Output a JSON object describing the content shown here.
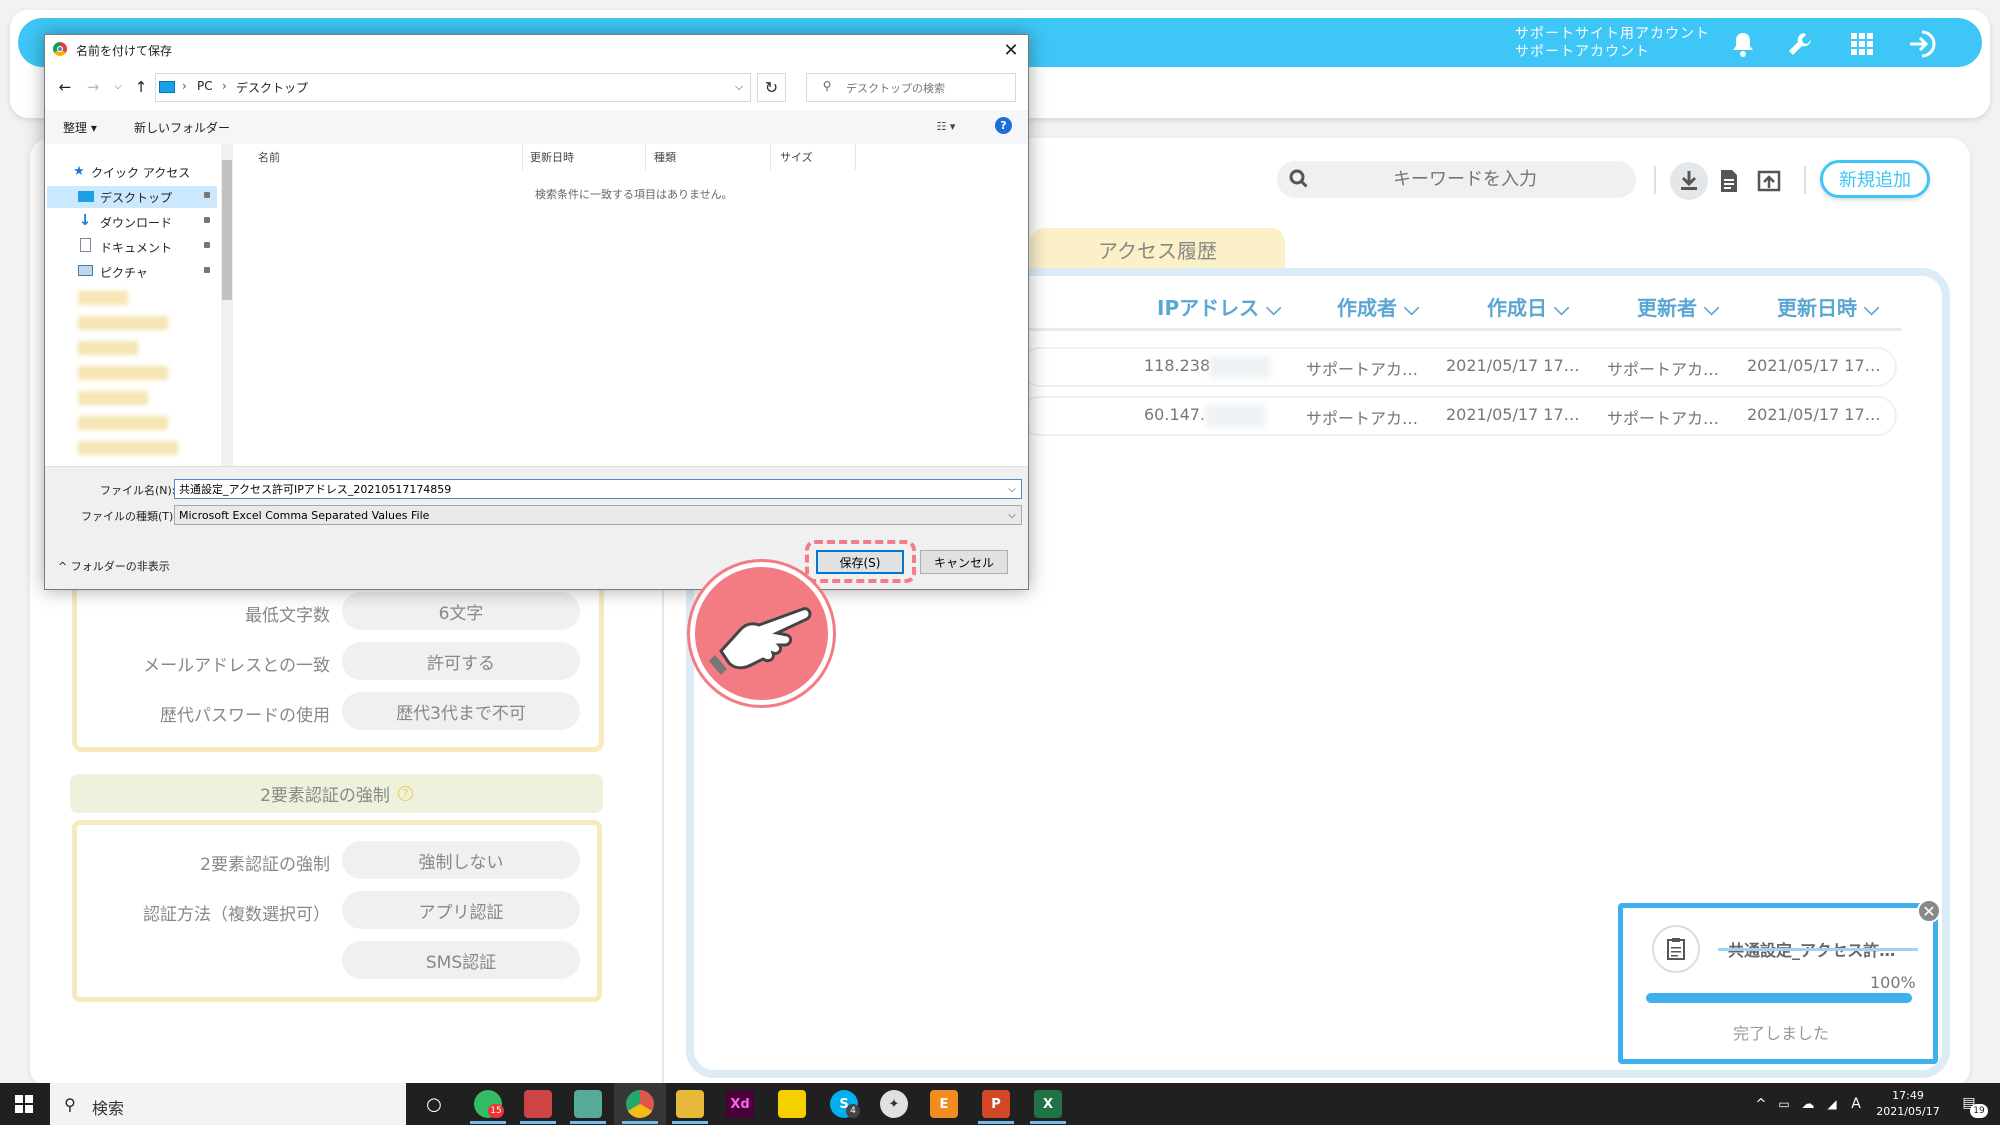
{
  "header": {
    "account_line1": "サポートサイト用アカウント",
    "account_line2": "サポートアカウント",
    "icons": [
      "bell-icon",
      "wrench-icon",
      "apps-grid-icon",
      "logout-icon"
    ],
    "brand_color": "#3ec6f6"
  },
  "toolbar": {
    "search_placeholder": "キーワードを入力",
    "new_button": "新規追加"
  },
  "tab": {
    "label": "アクセス履歴"
  },
  "table": {
    "columns": [
      "IPアドレス",
      "作成者",
      "作成日",
      "更新者",
      "更新日時"
    ],
    "rows": [
      {
        "ip": "118.238",
        "creator": "サポートアカ…",
        "created": "2021/05/17 17…",
        "updater": "サポートアカ…",
        "updated": "2021/05/17 17…"
      },
      {
        "ip": "60.147.",
        "creator": "サポートアカ…",
        "created": "2021/05/17 17…",
        "updater": "サポートアカ…",
        "updated": "2021/05/17 17…"
      }
    ]
  },
  "password_policy": [
    {
      "label": "最低文字数",
      "value": "6文字"
    },
    {
      "label": "メールアドレスとの一致",
      "value": "許可する"
    },
    {
      "label": "歴代パスワードの使用",
      "value": "歴代3代まで不可"
    }
  ],
  "tfa": {
    "title": "2要素認証の強制",
    "rows": [
      {
        "label": "2要素認証の強制",
        "value": "強制しない"
      },
      {
        "label": "認証方法（複数選択可）",
        "value": "アプリ認証"
      },
      {
        "label": "",
        "value": "SMS認証"
      }
    ]
  },
  "download": {
    "filename": "共通設定_アクセス許…",
    "percent_label": "100%",
    "progress": 1.0,
    "status": "完了しました"
  },
  "dialog": {
    "title": "名前を付けて保存",
    "path_pc": "PC",
    "path_folder": "デスクトップ",
    "search_placeholder": "デスクトップの検索",
    "organize": "整理 ▾",
    "new_folder": "新しいフォルダー",
    "columns": [
      "名前",
      "更新日時",
      "種類",
      "サイズ"
    ],
    "empty_message": "検索条件に一致する項目はありません。",
    "nav_items": [
      "クイック アクセス",
      "デスクトップ",
      "ダウンロード",
      "ドキュメント",
      "ピクチャ"
    ],
    "filename_label": "ファイル名(N):",
    "filename_value": "共通設定_アクセス許可IPアドレス_20210517174859",
    "filetype_label": "ファイルの種類(T):",
    "filetype_value": "Microsoft Excel Comma Separated Values File",
    "hide_folders": "フォルダーの非表示",
    "save_button": "保存(S)",
    "cancel_button": "キャンセル"
  },
  "taskbar": {
    "search_label": "検索",
    "time": "17:49",
    "date": "2021/05/17",
    "notifications": "19",
    "ime": "A",
    "badge_chrome": "15",
    "badge_skype": "4"
  }
}
